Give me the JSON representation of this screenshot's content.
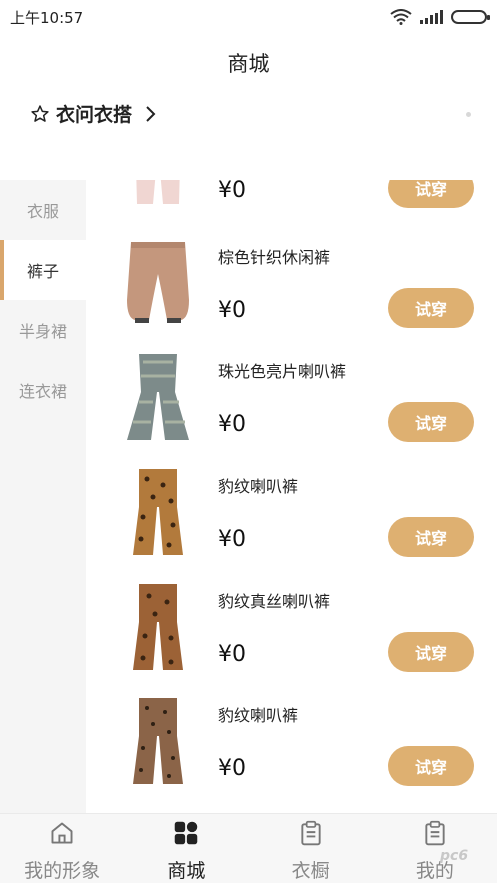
{
  "status_bar": {
    "time": "上午10:57"
  },
  "header": {
    "title": "商城"
  },
  "brand": {
    "label": "衣问衣搭"
  },
  "sidebar": {
    "items": [
      {
        "label": "衣服",
        "active": false
      },
      {
        "label": "裤子",
        "active": true
      },
      {
        "label": "半身裙",
        "active": false
      },
      {
        "label": "连衣裙",
        "active": false
      }
    ]
  },
  "products": [
    {
      "name": "",
      "price": "¥0",
      "button": "试穿",
      "color": "#f0d6d2"
    },
    {
      "name": "棕色针织休闲裤",
      "price": "¥0",
      "button": "试穿",
      "color": "#c4977d"
    },
    {
      "name": "珠光色亮片喇叭裤",
      "price": "¥0",
      "button": "试穿",
      "color": "#7d8b8a"
    },
    {
      "name": "豹纹喇叭裤",
      "price": "¥0",
      "button": "试穿",
      "color": "#b27a3c"
    },
    {
      "name": "豹纹真丝喇叭裤",
      "price": "¥0",
      "button": "试穿",
      "color": "#9c6236"
    },
    {
      "name": "豹纹喇叭裤",
      "price": "¥0",
      "button": "试穿",
      "color": "#8b6448"
    }
  ],
  "tabbar": {
    "tabs": [
      {
        "label": "我的形象",
        "icon": "home-icon",
        "active": false
      },
      {
        "label": "商城",
        "icon": "grid-icon",
        "active": true
      },
      {
        "label": "衣橱",
        "icon": "clipboard-icon",
        "active": false
      },
      {
        "label": "我的",
        "icon": "clipboard-icon",
        "active": false
      }
    ]
  },
  "watermark": "pc6",
  "colors": {
    "accent": "#deb071",
    "active_marker": "#d9a66c",
    "sidebar_bg": "#f5f5f5"
  }
}
